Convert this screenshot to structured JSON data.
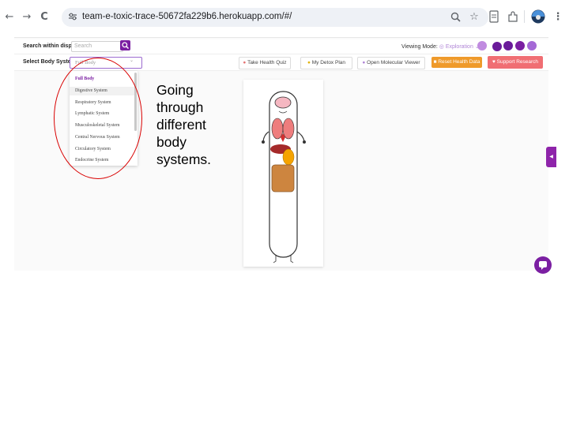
{
  "browser": {
    "url": "team-e-toxic-trace-50672fa229b6.herokuapp.com/#/",
    "back_icon": "←",
    "forward_icon": "→",
    "reload_icon": "C"
  },
  "header": {
    "search_label": "Search within display",
    "search_placeholder": "Search",
    "viewing_mode_label": "Viewing Mode:",
    "viewing_mode_value": "Exploration"
  },
  "toolbar": {
    "select_label": "Select Body System:",
    "select_value": "Full Body",
    "health_quiz": "Take Health Quiz",
    "detox_plan": "My Detox Plan",
    "molecular_viewer": "Open Molecular Viewer",
    "reset_health": "Reset Health Data",
    "support_research": "Support Research"
  },
  "dropdown": {
    "options": [
      "Full Body",
      "Digestive System",
      "Respiratory System",
      "Lymphatic System",
      "Musculoskeletal System",
      "Central Nervous System",
      "Circulatory System",
      "Endocrine System"
    ]
  },
  "caption": {
    "line1": "Going",
    "line2": "through",
    "line3": "different",
    "line4": "body",
    "line5": "systems."
  },
  "colors": {
    "accent": "#7b1fa2",
    "reset": "#ef9a2a",
    "support": "#f06e73",
    "annotation": "#d90000"
  }
}
